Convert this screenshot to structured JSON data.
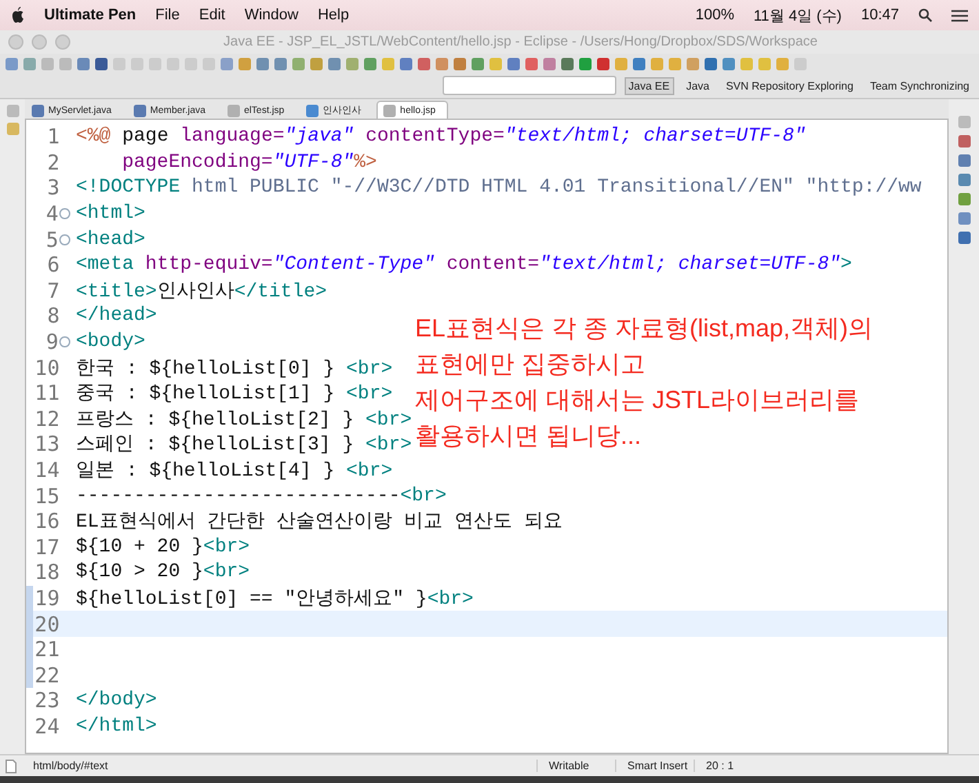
{
  "menubar": {
    "app": "Ultimate Pen",
    "items": [
      "File",
      "Edit",
      "Window",
      "Help"
    ],
    "battery": "100%",
    "date": "11월 4일 (수)",
    "time": "10:47"
  },
  "window": {
    "title": "Java EE - JSP_EL_JSTL/WebContent/hello.jsp - Eclipse - /Users/Hong/Dropbox/SDS/Workspace"
  },
  "perspectives": [
    {
      "label": "Java EE",
      "selected": true
    },
    {
      "label": "Java",
      "selected": false
    },
    {
      "label": "SVN Repository Exploring",
      "selected": false
    },
    {
      "label": "Team Synchronizing",
      "selected": false
    }
  ],
  "tabs": [
    {
      "label": "MyServlet.java",
      "kind": "java",
      "selected": false
    },
    {
      "label": "Member.java",
      "kind": "java",
      "selected": false
    },
    {
      "label": "elTest.jsp",
      "kind": "jsp",
      "selected": false
    },
    {
      "label": "인사인사",
      "kind": "web",
      "selected": false
    },
    {
      "label": "hello.jsp",
      "kind": "jsp",
      "selected": true
    }
  ],
  "editor": {
    "lines": [
      {
        "number": "1",
        "fold": false,
        "current": false,
        "changed": false,
        "segments": [
          {
            "kind": "jsp",
            "text": "<%@"
          },
          {
            "kind": "plain",
            "text": " page "
          },
          {
            "kind": "attr",
            "text": "language="
          },
          {
            "kind": "value",
            "text": "\"java\""
          },
          {
            "kind": "attr",
            "text": " contentType="
          },
          {
            "kind": "value",
            "text": "\"text/html; charset=UTF-8\""
          }
        ]
      },
      {
        "number": "2",
        "fold": false,
        "current": false,
        "changed": false,
        "segments": [
          {
            "kind": "attr",
            "text": "    pageEncoding="
          },
          {
            "kind": "value",
            "text": "\"UTF-8\""
          },
          {
            "kind": "jsp",
            "text": "%>"
          }
        ]
      },
      {
        "number": "3",
        "fold": false,
        "current": false,
        "changed": false,
        "segments": [
          {
            "kind": "tag",
            "text": "<!DOCTYPE"
          },
          {
            "kind": "doctype",
            "text": " html PUBLIC \"-//W3C//DTD HTML 4.01 Transitional//EN\" \"http://ww"
          }
        ]
      },
      {
        "number": "4",
        "fold": true,
        "current": false,
        "changed": false,
        "segments": [
          {
            "kind": "tag",
            "text": "<html>"
          }
        ]
      },
      {
        "number": "5",
        "fold": true,
        "current": false,
        "changed": false,
        "segments": [
          {
            "kind": "tag",
            "text": "<head>"
          }
        ]
      },
      {
        "number": "6",
        "fold": false,
        "current": false,
        "changed": false,
        "segments": [
          {
            "kind": "tag",
            "text": "<meta "
          },
          {
            "kind": "attr",
            "text": "http-equiv="
          },
          {
            "kind": "value",
            "text": "\"Content-Type\""
          },
          {
            "kind": "attr",
            "text": " content="
          },
          {
            "kind": "value",
            "text": "\"text/html; charset=UTF-8\""
          },
          {
            "kind": "tag",
            "text": ">"
          }
        ]
      },
      {
        "number": "7",
        "fold": false,
        "current": false,
        "changed": false,
        "segments": [
          {
            "kind": "tag",
            "text": "<title>"
          },
          {
            "kind": "plain",
            "text": "인사인사"
          },
          {
            "kind": "tag",
            "text": "</title>"
          }
        ]
      },
      {
        "number": "8",
        "fold": false,
        "current": false,
        "changed": false,
        "segments": [
          {
            "kind": "tag",
            "text": "</head>"
          }
        ]
      },
      {
        "number": "9",
        "fold": true,
        "current": false,
        "changed": false,
        "segments": [
          {
            "kind": "tag",
            "text": "<body>"
          }
        ]
      },
      {
        "number": "10",
        "fold": false,
        "current": false,
        "changed": false,
        "segments": [
          {
            "kind": "plain",
            "text": "한국 : ${helloList[0] } "
          },
          {
            "kind": "tag",
            "text": "<br>"
          }
        ]
      },
      {
        "number": "11",
        "fold": false,
        "current": false,
        "changed": false,
        "segments": [
          {
            "kind": "plain",
            "text": "중국 : ${helloList[1] } "
          },
          {
            "kind": "tag",
            "text": "<br>"
          }
        ]
      },
      {
        "number": "12",
        "fold": false,
        "current": false,
        "changed": false,
        "segments": [
          {
            "kind": "plain",
            "text": "프랑스 : ${helloList[2] } "
          },
          {
            "kind": "tag",
            "text": "<br>"
          }
        ]
      },
      {
        "number": "13",
        "fold": false,
        "current": false,
        "changed": false,
        "segments": [
          {
            "kind": "plain",
            "text": "스페인 : ${helloList[3] } "
          },
          {
            "kind": "tag",
            "text": "<br>"
          }
        ]
      },
      {
        "number": "14",
        "fold": false,
        "current": false,
        "changed": false,
        "segments": [
          {
            "kind": "plain",
            "text": "일본 : ${helloList[4] } "
          },
          {
            "kind": "tag",
            "text": "<br>"
          }
        ]
      },
      {
        "number": "15",
        "fold": false,
        "current": false,
        "changed": false,
        "segments": [
          {
            "kind": "plain",
            "text": "----------------------------"
          },
          {
            "kind": "tag",
            "text": "<br>"
          }
        ]
      },
      {
        "number": "16",
        "fold": false,
        "current": false,
        "changed": false,
        "segments": [
          {
            "kind": "plain",
            "text": "EL표현식에서 간단한 산술연산이랑 비교 연산도 되요"
          }
        ]
      },
      {
        "number": "17",
        "fold": false,
        "current": false,
        "changed": false,
        "segments": [
          {
            "kind": "plain",
            "text": "${10 + 20 }"
          },
          {
            "kind": "tag",
            "text": "<br>"
          }
        ]
      },
      {
        "number": "18",
        "fold": false,
        "current": false,
        "changed": false,
        "segments": [
          {
            "kind": "plain",
            "text": "${10 > 20 }"
          },
          {
            "kind": "tag",
            "text": "<br>"
          }
        ]
      },
      {
        "number": "19",
        "fold": false,
        "current": false,
        "changed": true,
        "segments": [
          {
            "kind": "plain",
            "text": "${helloList[0] == \"안녕하세요\" }"
          },
          {
            "kind": "tag",
            "text": "<br>"
          }
        ]
      },
      {
        "number": "20",
        "fold": false,
        "current": true,
        "changed": true
      },
      {
        "number": "21",
        "fold": false,
        "current": false,
        "changed": true
      },
      {
        "number": "22",
        "fold": false,
        "current": false,
        "changed": true
      },
      {
        "number": "23",
        "fold": false,
        "current": false,
        "changed": false,
        "segments": [
          {
            "kind": "tag",
            "text": "</body>"
          }
        ]
      },
      {
        "number": "24",
        "fold": false,
        "current": false,
        "changed": false,
        "segments": [
          {
            "kind": "tag",
            "text": "</html>"
          }
        ]
      }
    ]
  },
  "annotation": [
    "EL표현식은 각 종 자료형(list,map,객체)의",
    "표현에만 집중하시고",
    "제어구조에 대해서는 JSTL라이브러리를",
    "활용하시면 됩니당..."
  ],
  "status_bar": {
    "path": "html/body/#text",
    "mode": "Writable",
    "insert": "Smart Insert",
    "position": "20 : 1"
  }
}
